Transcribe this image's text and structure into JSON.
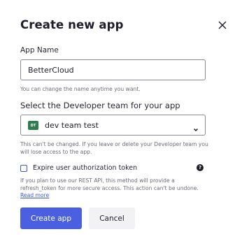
{
  "dialog": {
    "title": "Create new app",
    "close_icon": "close-icon"
  },
  "app_name": {
    "label": "App Name",
    "value": "BetterCloud",
    "help": "You can change the name anytime you want."
  },
  "team": {
    "label": "Select the Developer team for your app",
    "badge": "DT",
    "selected": "dev team test",
    "help": "This can't be changed. If you leave or delete your Developer team you will lose access to the app."
  },
  "expire": {
    "label": "Expire user authorization token",
    "checked": false,
    "help": "If you plan to use our REST API, this method will provide a refresh_token for more secure access. This action can't be undone.",
    "read_more": "Read more"
  },
  "actions": {
    "create": "Create app",
    "cancel": "Cancel"
  },
  "colors": {
    "primary": "#4a60e0",
    "team_badge": "#2e7d4f",
    "link": "#3b5bd6"
  }
}
